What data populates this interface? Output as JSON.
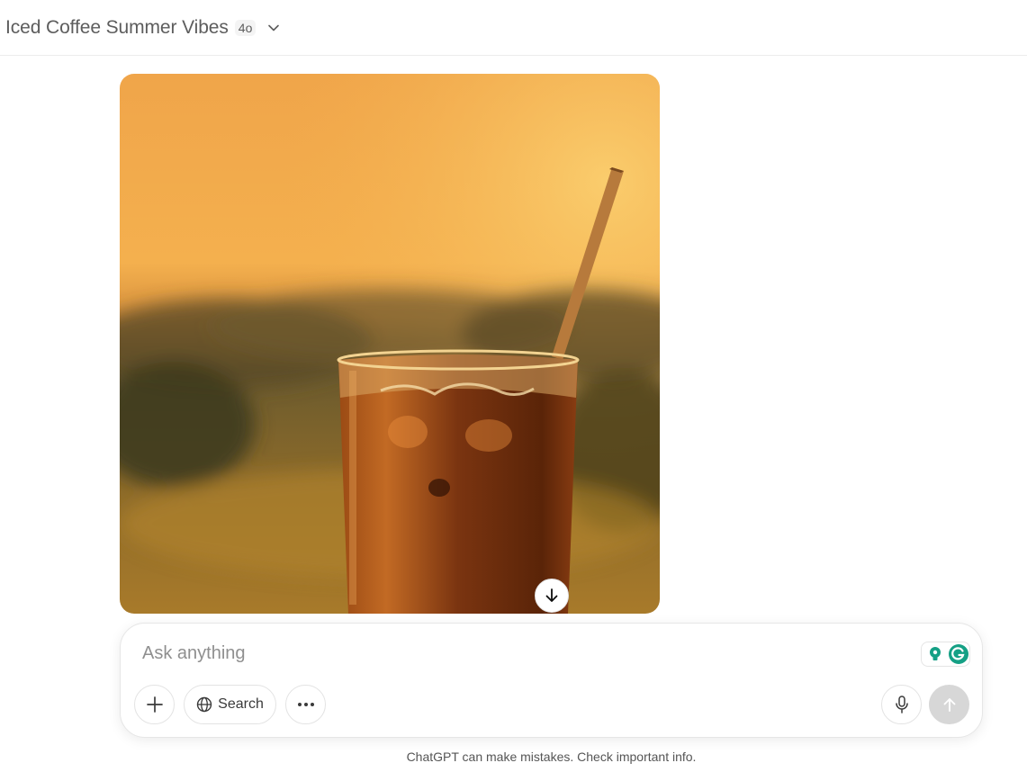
{
  "header": {
    "title": "Iced Coffee Summer Vibes",
    "model_badge": "4o"
  },
  "conversation": {
    "image_description_icon": "generated-image"
  },
  "composer": {
    "placeholder": "Ask anything",
    "search_label": "Search",
    "icons": [
      "plus-icon",
      "globe-icon",
      "more-icon",
      "mic-icon",
      "send-arrow-icon"
    ]
  },
  "footer": {
    "disclaimer": "ChatGPT can make mistakes. Check important info."
  },
  "colors": {
    "sky_top": "#f0a94a",
    "sky_glow": "#f7c15a",
    "coffee": "#8a3d10",
    "straw": "#b87a3c",
    "send_disabled": "#d7d7d7"
  }
}
